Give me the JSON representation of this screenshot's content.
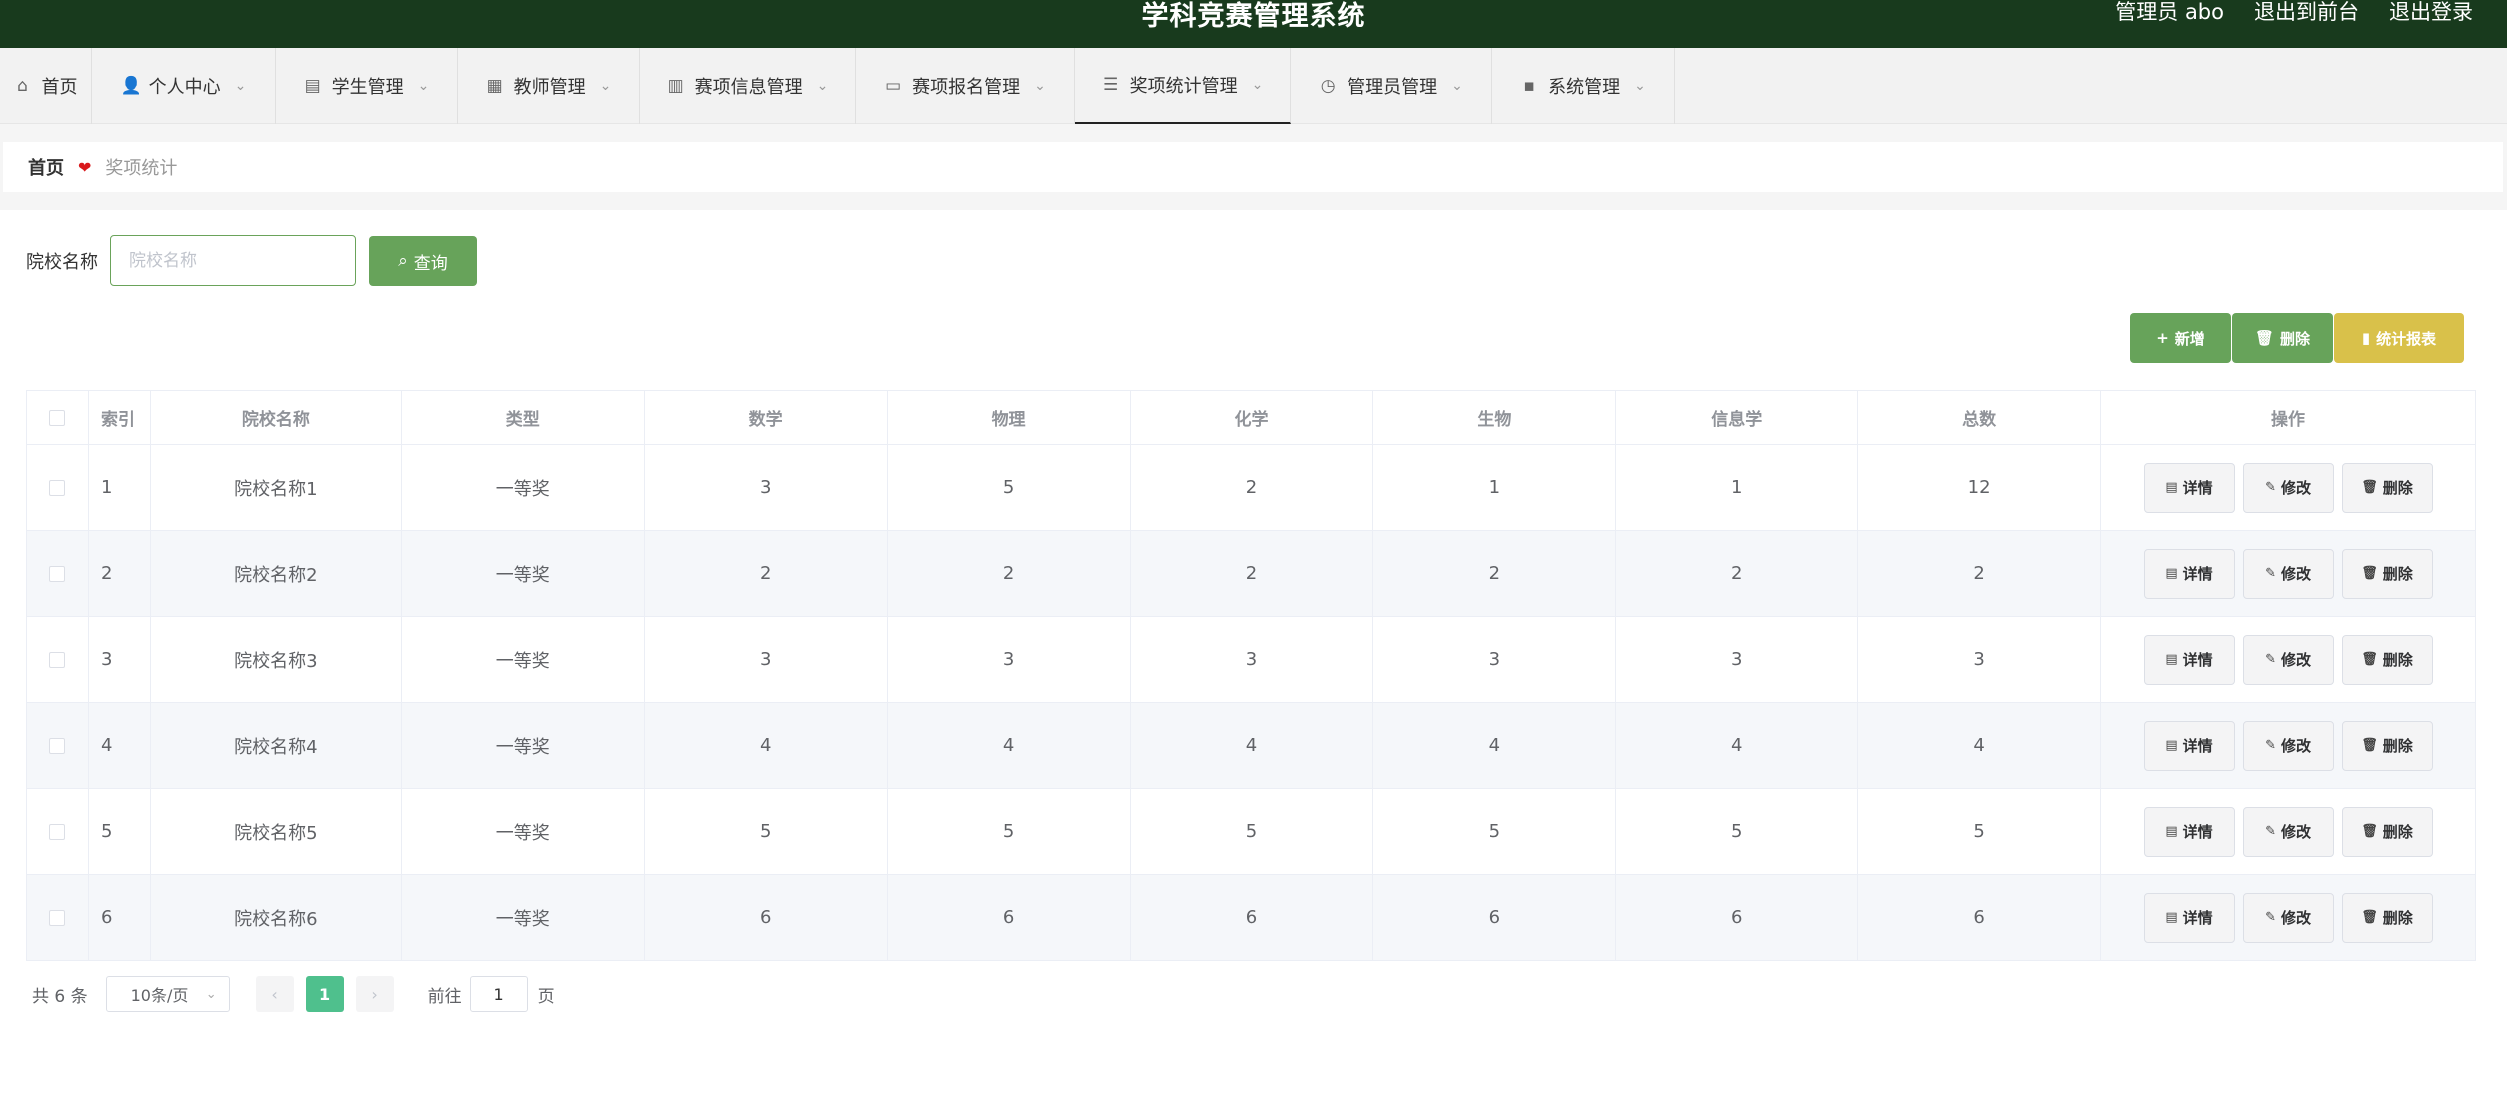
{
  "header": {
    "title": "学科竞赛管理系统",
    "user": "管理员 abo",
    "front_link": "退出到前台",
    "logout_link": "退出登录"
  },
  "nav": {
    "items": [
      {
        "label": "首页",
        "icon": "home-icon",
        "glyph": "⌂",
        "dropdown": false
      },
      {
        "label": "个人中心",
        "icon": "user-icon",
        "glyph": "👤",
        "dropdown": true
      },
      {
        "label": "学生管理",
        "icon": "briefcase-icon",
        "glyph": "▤",
        "dropdown": true
      },
      {
        "label": "教师管理",
        "icon": "grid-icon",
        "glyph": "▦",
        "dropdown": true
      },
      {
        "label": "赛项信息管理",
        "icon": "chart-icon",
        "glyph": "▥",
        "dropdown": true
      },
      {
        "label": "赛项报名管理",
        "icon": "ticket-icon",
        "glyph": "▭",
        "dropdown": true
      },
      {
        "label": "奖项统计管理",
        "icon": "sliders-icon",
        "glyph": "☰",
        "dropdown": true,
        "active": true
      },
      {
        "label": "管理员管理",
        "icon": "gauge-icon",
        "glyph": "◷",
        "dropdown": true
      },
      {
        "label": "系统管理",
        "icon": "chat-icon",
        "glyph": "▪",
        "dropdown": true
      }
    ]
  },
  "breadcrumb": {
    "home": "首页",
    "current": "奖项统计"
  },
  "search": {
    "label": "院校名称",
    "placeholder": "院校名称",
    "button": "查询"
  },
  "actions": {
    "add": "新增",
    "delete": "删除",
    "report": "统计报表"
  },
  "table": {
    "headers": [
      "索引",
      "院校名称",
      "类型",
      "数学",
      "物理",
      "化学",
      "生物",
      "信息学",
      "总数",
      "操作"
    ],
    "rows": [
      {
        "index": "1",
        "school": "院校名称1",
        "type": "一等奖",
        "math": "3",
        "physics": "5",
        "chemistry": "2",
        "biology": "1",
        "informatics": "1",
        "total": "12"
      },
      {
        "index": "2",
        "school": "院校名称2",
        "type": "一等奖",
        "math": "2",
        "physics": "2",
        "chemistry": "2",
        "biology": "2",
        "informatics": "2",
        "total": "2"
      },
      {
        "index": "3",
        "school": "院校名称3",
        "type": "一等奖",
        "math": "3",
        "physics": "3",
        "chemistry": "3",
        "biology": "3",
        "informatics": "3",
        "total": "3"
      },
      {
        "index": "4",
        "school": "院校名称4",
        "type": "一等奖",
        "math": "4",
        "physics": "4",
        "chemistry": "4",
        "biology": "4",
        "informatics": "4",
        "total": "4"
      },
      {
        "index": "5",
        "school": "院校名称5",
        "type": "一等奖",
        "math": "5",
        "physics": "5",
        "chemistry": "5",
        "biology": "5",
        "informatics": "5",
        "total": "5"
      },
      {
        "index": "6",
        "school": "院校名称6",
        "type": "一等奖",
        "math": "6",
        "physics": "6",
        "chemistry": "6",
        "biology": "6",
        "informatics": "6",
        "total": "6"
      }
    ],
    "row_actions": {
      "detail": "详情",
      "edit": "修改",
      "delete": "删除"
    }
  },
  "pagination": {
    "total": "共 6 条",
    "page_size": "10条/页",
    "current_page": "1",
    "goto_prefix": "前往",
    "goto_value": "1",
    "goto_suffix": "页"
  },
  "colors": {
    "header_bg": "#183a1d",
    "primary": "#67a35a",
    "report": "#d9c14a",
    "page_active": "#4fc08d",
    "heart": "#d9191c"
  }
}
